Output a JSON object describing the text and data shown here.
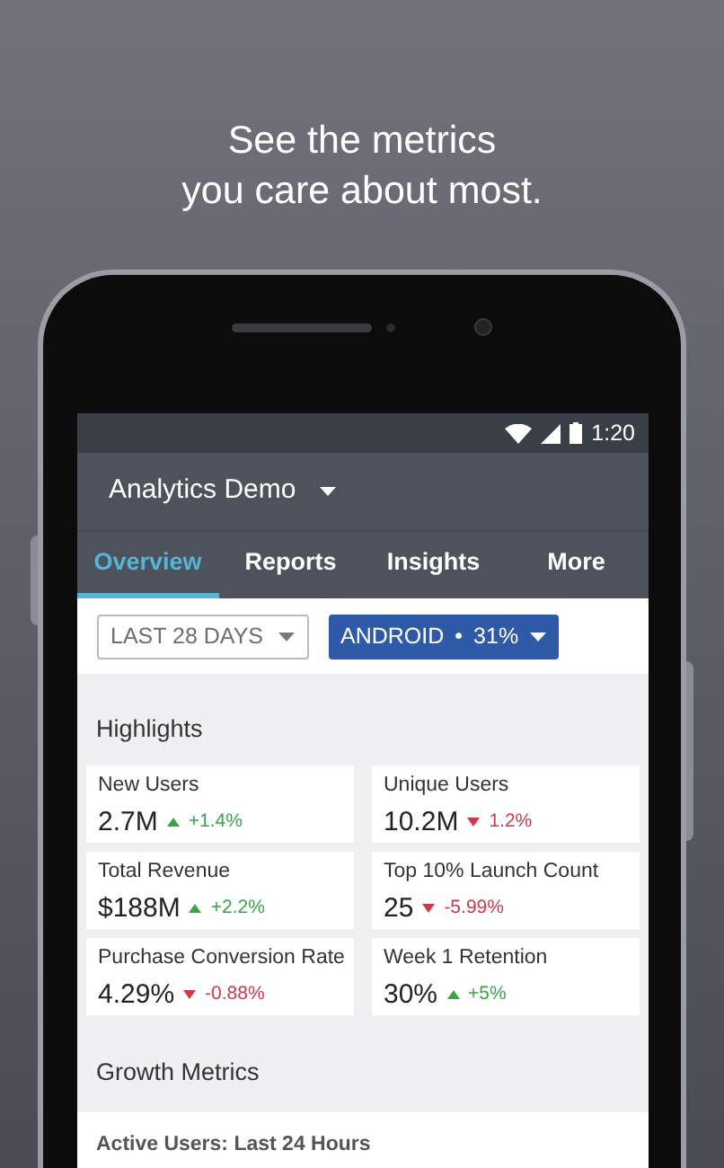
{
  "headline": [
    "See the metrics",
    "you care about most."
  ],
  "status_bar": {
    "time": "1:20"
  },
  "app_bar": {
    "title": "Analytics Demo"
  },
  "tabs": [
    {
      "label": "Overview",
      "selected": true
    },
    {
      "label": "Reports",
      "selected": false
    },
    {
      "label": "Insights",
      "selected": false
    },
    {
      "label": "More",
      "selected": false
    }
  ],
  "filters": [
    {
      "kind": "outline",
      "label": "LAST 28 DAYS"
    },
    {
      "kind": "filled",
      "label": "ANDROID",
      "separator": "•",
      "extra": "31%"
    }
  ],
  "highlights": {
    "title": "Highlights",
    "metrics": [
      {
        "label": "New Users",
        "value": "2.7M",
        "change": "+1.4%",
        "kind": "up"
      },
      {
        "label": "Unique Users",
        "value": "10.2M",
        "change": "1.2%",
        "kind": "down"
      },
      {
        "label": "Total Revenue",
        "value": "$188M",
        "change": "+2.2%",
        "kind": "up"
      },
      {
        "label": "Top 10% Launch Count",
        "value": "25",
        "change": "-5.99%",
        "kind": "down"
      },
      {
        "label": "Purchase Conversion Rate",
        "value": "4.29%",
        "change": "-0.88%",
        "kind": "down"
      },
      {
        "label": "Week 1 Retention",
        "value": "30%",
        "change": "+5%",
        "kind": "up"
      }
    ]
  },
  "growth": {
    "title": "Growth Metrics",
    "card_title": "Active Users: Last 24 Hours"
  }
}
